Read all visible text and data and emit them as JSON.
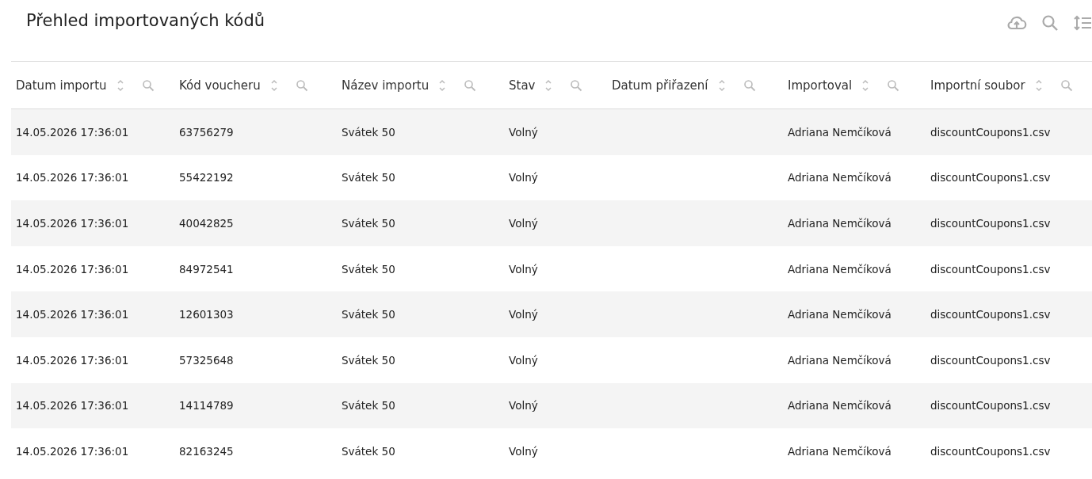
{
  "title": "Přehled importovaných kódů",
  "columns": [
    {
      "label": "Datum importu"
    },
    {
      "label": "Kód voucheru"
    },
    {
      "label": "Název importu"
    },
    {
      "label": "Stav"
    },
    {
      "label": "Datum přiřazení"
    },
    {
      "label": "Importoval"
    },
    {
      "label": "Importní soubor"
    }
  ],
  "rows": [
    {
      "datum_importu": "14.05.2026 17:36:01",
      "kod_voucheru": "63756279",
      "nazev_importu": "Svátek 50",
      "stav": "Volný",
      "importoval": "Adriana Nemčíková",
      "importni_soubor": "discountCoupons1.csv"
    },
    {
      "datum_importu": "14.05.2026 17:36:01",
      "kod_voucheru": "55422192",
      "nazev_importu": "Svátek 50",
      "stav": "Volný",
      "importoval": "Adriana Nemčíková",
      "importni_soubor": "discountCoupons1.csv"
    },
    {
      "datum_importu": "14.05.2026 17:36:01",
      "kod_voucheru": "40042825",
      "nazev_importu": "Svátek 50",
      "stav": "Volný",
      "importoval": "Adriana Nemčíková",
      "importni_soubor": "discountCoupons1.csv"
    },
    {
      "datum_importu": "14.05.2026 17:36:01",
      "kod_voucheru": "84972541",
      "nazev_importu": "Svátek 50",
      "stav": "Volný",
      "importoval": "Adriana Nemčíková",
      "importni_soubor": "discountCoupons1.csv"
    },
    {
      "datum_importu": "14.05.2026 17:36:01",
      "kod_voucheru": "12601303",
      "nazev_importu": "Svátek 50",
      "stav": "Volný",
      "importoval": "Adriana Nemčíková",
      "importni_soubor": "discountCoupons1.csv"
    },
    {
      "datum_importu": "14.05.2026 17:36:01",
      "kod_voucheru": "57325648",
      "nazev_importu": "Svátek 50",
      "stav": "Volný",
      "importoval": "Adriana Nemčíková",
      "importni_soubor": "discountCoupons1.csv"
    },
    {
      "datum_importu": "14.05.2026 17:36:01",
      "kod_voucheru": "14114789",
      "nazev_importu": "Svátek 50",
      "stav": "Volný",
      "importoval": "Adriana Nemčíková",
      "importni_soubor": "discountCoupons1.csv"
    },
    {
      "datum_importu": "14.05.2026 17:36:01",
      "kod_voucheru": "82163245",
      "nazev_importu": "Svátek 50",
      "stav": "Volný",
      "importoval": "Adriana Nemčíková",
      "importni_soubor": "discountCoupons1.csv"
    }
  ]
}
